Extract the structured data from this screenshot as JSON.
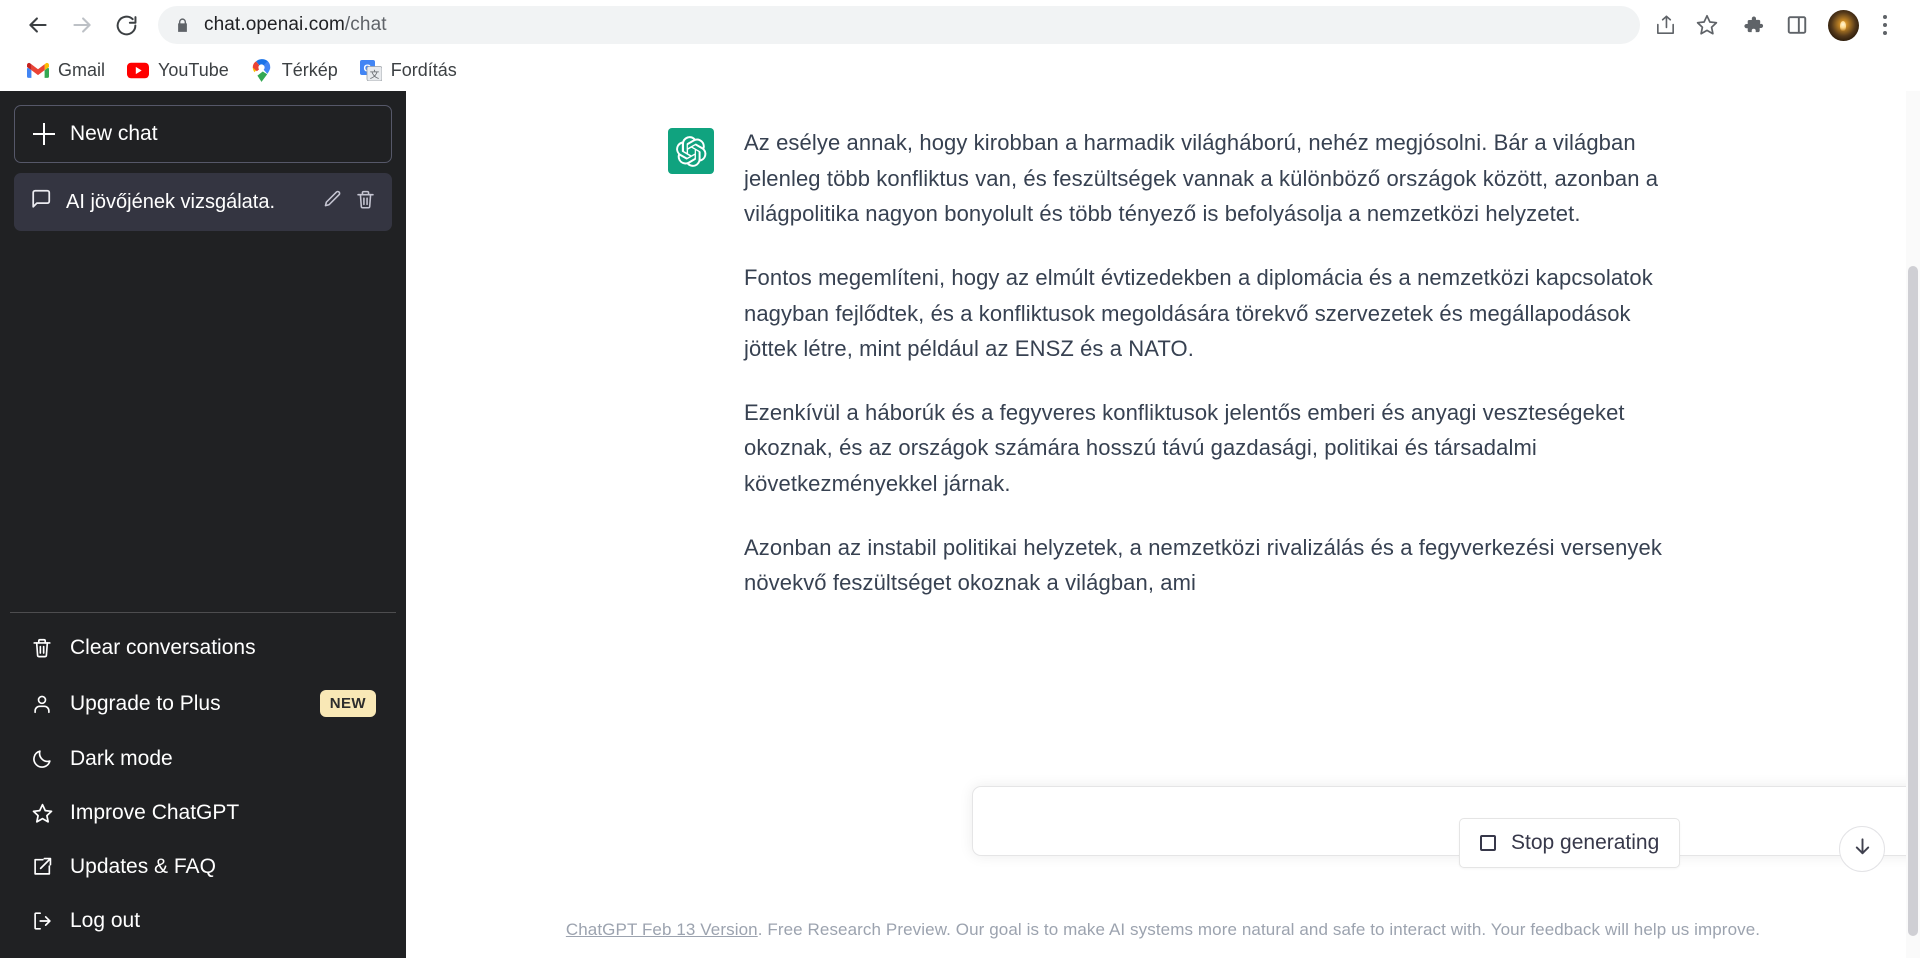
{
  "browser": {
    "nav": {
      "back": "back-arrow",
      "forward": "forward-arrow",
      "reload": "reload-icon"
    },
    "omnibox": {
      "lock_icon": "lock-icon",
      "url_host": "chat.openai.com",
      "url_path": "/chat",
      "share_icon": "share-icon",
      "bookmark_icon": "star-icon"
    },
    "toolbar_icons": {
      "extensions": "puzzle-icon",
      "side_panel": "sidebar-panel-icon",
      "profile": "profile-avatar",
      "menu": "three-dot-menu-icon"
    },
    "bookmarks": [
      {
        "label": "Gmail",
        "icon": "gmail-icon"
      },
      {
        "label": "YouTube",
        "icon": "youtube-icon"
      },
      {
        "label": "Térkép",
        "icon": "google-maps-icon"
      },
      {
        "label": "Fordítás",
        "icon": "google-translate-icon"
      }
    ]
  },
  "sidebar": {
    "new_chat": {
      "label": "New chat",
      "icon": "plus-icon"
    },
    "conversations": [
      {
        "title": "AI jövőjének vizsgálata.",
        "icon": "chat-bubble-icon",
        "edit_icon": "pencil-icon",
        "delete_icon": "trash-icon",
        "active": true
      }
    ],
    "menu": [
      {
        "label": "Clear conversations",
        "icon": "trash-icon"
      },
      {
        "label": "Upgrade to Plus",
        "icon": "person-icon",
        "badge": "NEW"
      },
      {
        "label": "Dark mode",
        "icon": "moon-icon"
      },
      {
        "label": "Improve ChatGPT",
        "icon": "star-icon"
      },
      {
        "label": "Updates & FAQ",
        "icon": "external-link-icon"
      },
      {
        "label": "Log out",
        "icon": "logout-icon"
      }
    ]
  },
  "chat": {
    "assistant_avatar": "openai-logo",
    "paragraphs": [
      "Az esélye annak, hogy kirobban a harmadik világháború, nehéz megjósolni. Bár a világban jelenleg több konfliktus van, és feszültségek vannak a különböző országok között, azonban a világpolitika nagyon bonyolult és több tényező is befolyásolja a nemzetközi helyzetet.",
      "Fontos megemlíteni, hogy az elmúlt évtizedekben a diplomácia és a nemzetközi kapcsolatok nagyban fejlődtek, és a konfliktusok megoldására törekvő szervezetek és megállapodások jöttek létre, mint például az ENSZ és a NATO.",
      "Ezenkívül a háborúk és a fegyveres konfliktusok jelentős emberi és anyagi veszteségeket okoznak, és az országok számára hosszú távú gazdasági, politikai és társadalmi következményekkel járnak.",
      "Azonban az instabil politikai helyzetek, a nemzetközi rivalizálás és a fegyverkezési versenyek növekvő feszültséget okoznak a világban, ami"
    ],
    "stop_generating": {
      "label": "Stop generating",
      "icon": "stop-square-icon"
    },
    "scroll_down_icon": "arrow-down-icon"
  },
  "composer": {
    "value": "",
    "placeholder": "",
    "send_icon": "send-icon"
  },
  "footer": {
    "version_link": "ChatGPT Feb 13 Version",
    "disclaimer": ". Free Research Preview. Our goal is to make AI systems more natural and safe to interact with. Your feedback will help us improve."
  },
  "colors": {
    "brand_green": "#10a37f",
    "sidebar_bg": "#202123",
    "sidebar_active": "#343541",
    "badge_new": "#f9e8b6",
    "text": "#374151"
  }
}
